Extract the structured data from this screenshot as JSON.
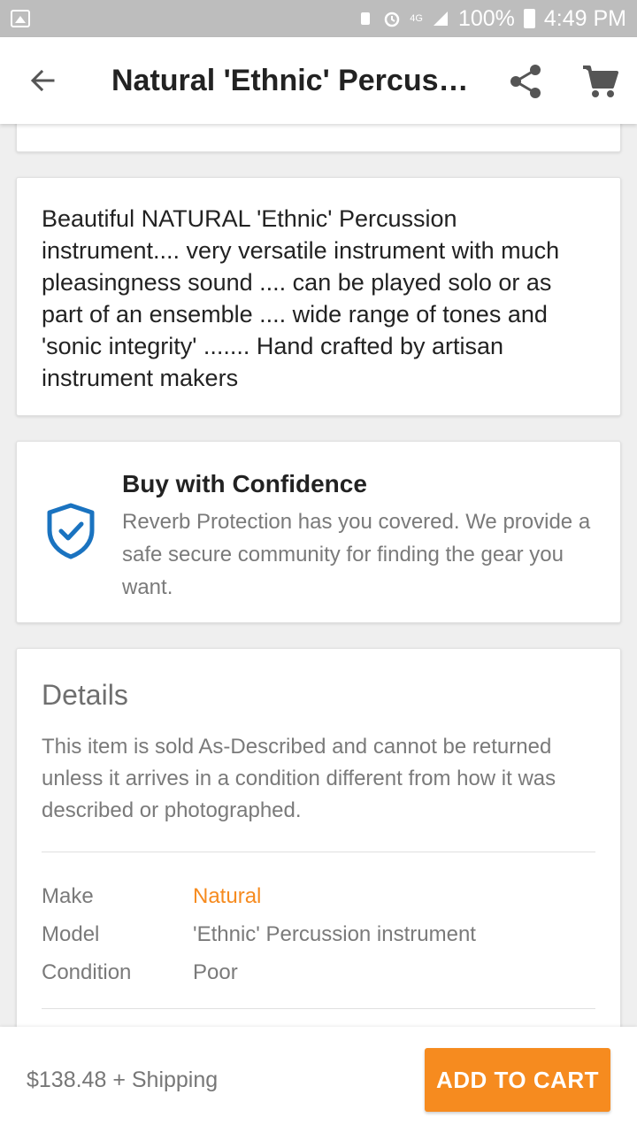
{
  "status_bar": {
    "battery": "100%",
    "time": "4:49 PM",
    "network": "4G"
  },
  "app_bar": {
    "title": "Natural  'Ethnic' Percussion instrument"
  },
  "description": {
    "text": "Beautiful NATURAL 'Ethnic' Percussion instrument.... very versatile instrument with much pleasingness sound .... can be played solo or as part of an ensemble .... wide range of tones and 'sonic integrity' ....... Hand crafted by artisan instrument makers"
  },
  "confidence": {
    "title": "Buy with Confidence",
    "body": "Reverb Protection has you covered. We provide a safe secure community for finding the gear you want.",
    "icon": "shield-check-icon"
  },
  "details": {
    "heading": "Details",
    "body": "This item is sold As-Described and cannot be returned unless it arrives in a condition different from how it was described or photographed.",
    "specs": [
      {
        "key": "Make",
        "value": "Natural"
      },
      {
        "key": "Model",
        "value": "'Ethnic' Percussion instrument"
      },
      {
        "key": "Condition",
        "value": "Poor"
      }
    ]
  },
  "bottom_bar": {
    "price": "$138.48 + Shipping",
    "add_to_cart": "ADD TO CART"
  },
  "colors": {
    "accent": "#f68b1f",
    "shield": "#1a73c0",
    "status_bar": "#bdbdbd"
  }
}
